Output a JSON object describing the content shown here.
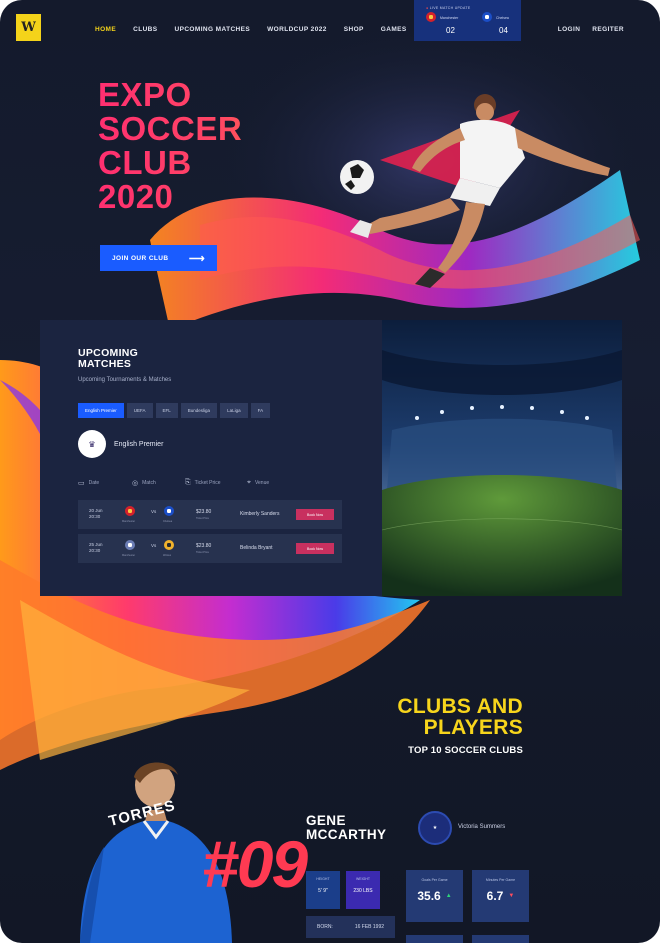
{
  "nav": {
    "logo": "W",
    "menu": [
      "HOME",
      "CLUBS",
      "UPCOMING MATCHES",
      "WORLDCUP 2022",
      "SHOP",
      "GAMES"
    ],
    "auth": [
      "LOGIN",
      "REGITER"
    ]
  },
  "live": {
    "title": "LIVE MATCH UPDATE",
    "home_team": "Manchester",
    "away_team": "Chelsea",
    "home_score": "02",
    "away_score": "04"
  },
  "hero": {
    "title_lines": [
      "EXPO",
      "SOCCER",
      "CLUB",
      "2020"
    ],
    "cta": "JOIN OUR CLUB",
    "cta_arrow": "⟶"
  },
  "upcoming": {
    "title": "UPCOMING MATCHES",
    "subtitle": "Upcoming Tournaments & Matches",
    "tabs": [
      "English Premier",
      "UEFA",
      "EFL",
      "Bundesliga",
      "LaLiga",
      "FA"
    ],
    "league_name": "English Premier",
    "columns": {
      "date": "Date",
      "match": "Match",
      "ticket": "Ticket Price",
      "venue": "Venue"
    },
    "rows": [
      {
        "date": "20 Jun 20:30",
        "team_a": "Manchester",
        "team_b": "Chelsea",
        "vs": "Vs",
        "price": "$23.80",
        "price_label": "Ticket Price",
        "venue": "Kimberly Sanders",
        "buy": "Book Now"
      },
      {
        "date": "25 Jun 20:30",
        "team_a": "Manchester",
        "team_b": "Wolves",
        "vs": "Vs",
        "price": "$23.80",
        "price_label": "Ticket Price",
        "venue": "Belinda Bryant",
        "buy": "Book Now"
      }
    ]
  },
  "clubs": {
    "title_line1": "CLUBS AND",
    "title_line2": "PLAYERS",
    "subtitle": "TOP 10 SOCCER CLUBS"
  },
  "player": {
    "name": "GENE MCCARTHY",
    "shirt_name": "TORRES",
    "number": "#09",
    "club": "Victoria Summers",
    "height_label": "HEIGHT",
    "height": "5' 9\"",
    "weight_label": "WEIGHT",
    "weight": "230 LBS",
    "born_label": "BORN:",
    "born": "16 FEB 1992",
    "kpi1_label": "Goals Per Game",
    "kpi1_value": "35.6",
    "kpi1_trend": "▲",
    "kpi2_label": "Minutes Per Game",
    "kpi2_value": "6.7",
    "kpi2_trend": "▼"
  }
}
